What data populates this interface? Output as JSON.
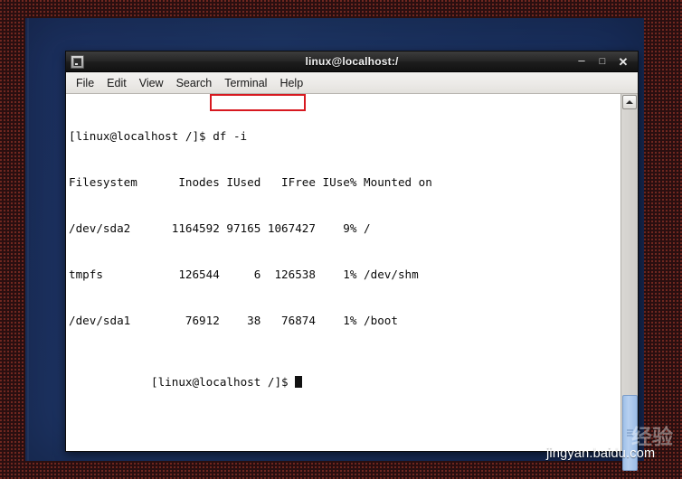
{
  "window": {
    "title": "linux@localhost:/",
    "icon": "terminal-icon",
    "controls": {
      "minimize": "–",
      "maximize": "□",
      "close": "✕"
    }
  },
  "menubar": {
    "items": [
      {
        "label": "File"
      },
      {
        "label": "Edit"
      },
      {
        "label": "View"
      },
      {
        "label": "Search"
      },
      {
        "label": "Terminal"
      },
      {
        "label": "Help"
      }
    ]
  },
  "terminal": {
    "prompt": "[linux@localhost /]$",
    "command": "df -i",
    "line_command": "[linux@localhost /]$ df -i",
    "line_header": "Filesystem      Inodes IUsed   IFree IUse% Mounted on",
    "line_sda2": "/dev/sda2      1164592 97165 1067427    9% /",
    "line_tmpfs": "tmpfs           126544     6  126538    1% /dev/shm",
    "line_sda1": "/dev/sda1        76912    38   76874    1% /boot",
    "line_prompt2": "[linux@localhost /]$",
    "table": {
      "columns": [
        "Filesystem",
        "Inodes",
        "IUsed",
        "IFree",
        "IUse%",
        "Mounted on"
      ],
      "rows": [
        {
          "filesystem": "/dev/sda2",
          "inodes": "1164592",
          "iused": "97165",
          "ifree": "1067427",
          "iuse_pct": "9%",
          "mounted_on": "/"
        },
        {
          "filesystem": "tmpfs",
          "inodes": "126544",
          "iused": "6",
          "ifree": "126538",
          "iuse_pct": "1%",
          "mounted_on": "/dev/shm"
        },
        {
          "filesystem": "/dev/sda1",
          "inodes": "76912",
          "iused": "38",
          "ifree": "76874",
          "iuse_pct": "1%",
          "mounted_on": "/boot"
        }
      ]
    },
    "highlight_color": "#d71920"
  },
  "scrollbar": {
    "up_arrow": "▲"
  },
  "watermark": {
    "brand": "Baidu",
    "paw": "✿",
    "cn_text": "经验",
    "url": "jingyan.baidu.com"
  }
}
